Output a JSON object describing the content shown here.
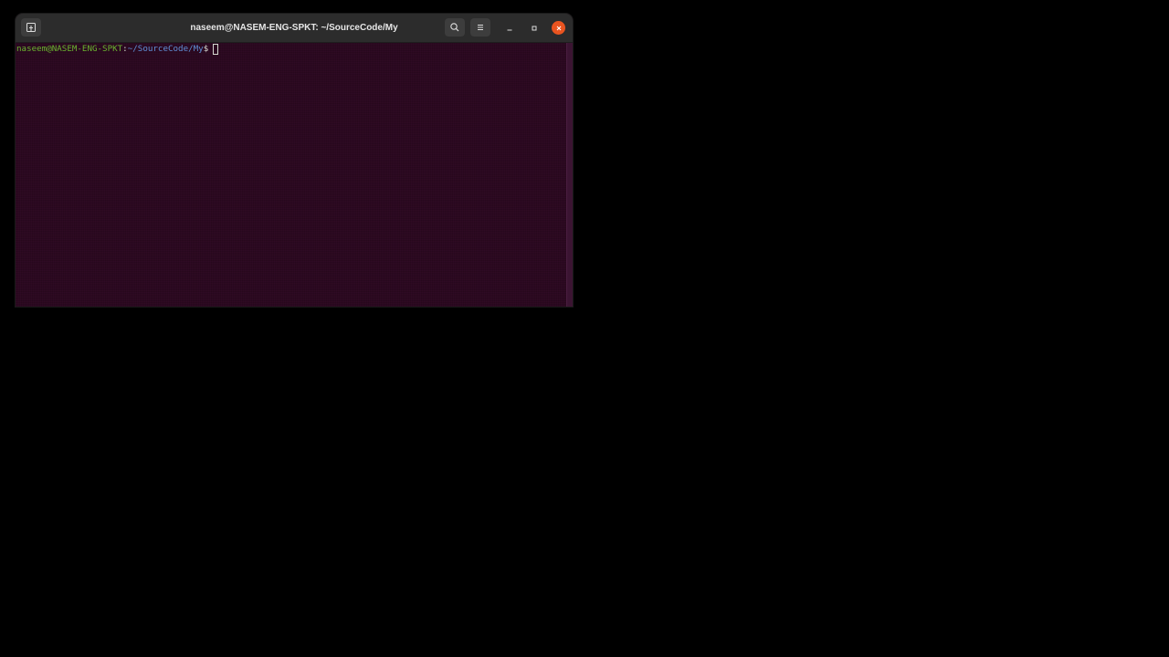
{
  "window": {
    "title": "naseem@NASEM-ENG-SPKT: ~/SourceCode/My"
  },
  "icons": {
    "new_tab": "new-tab-icon",
    "search": "search-icon",
    "menu": "hamburger-menu-icon",
    "minimize": "minimize-icon",
    "maximize": "maximize-icon",
    "close": "close-icon"
  },
  "terminal": {
    "prompt_user_host": "naseem@NASEM-ENG-SPKT",
    "prompt_colon": ":",
    "prompt_path": "~/SourceCode/My",
    "prompt_symbol": "$",
    "input": ""
  },
  "colors": {
    "terminal_background": "#300a24",
    "titlebar_background": "#2c2c2c",
    "prompt_user_color": "#6ab42f",
    "prompt_path_color": "#5f8fd6",
    "close_button_color": "#e95420"
  }
}
